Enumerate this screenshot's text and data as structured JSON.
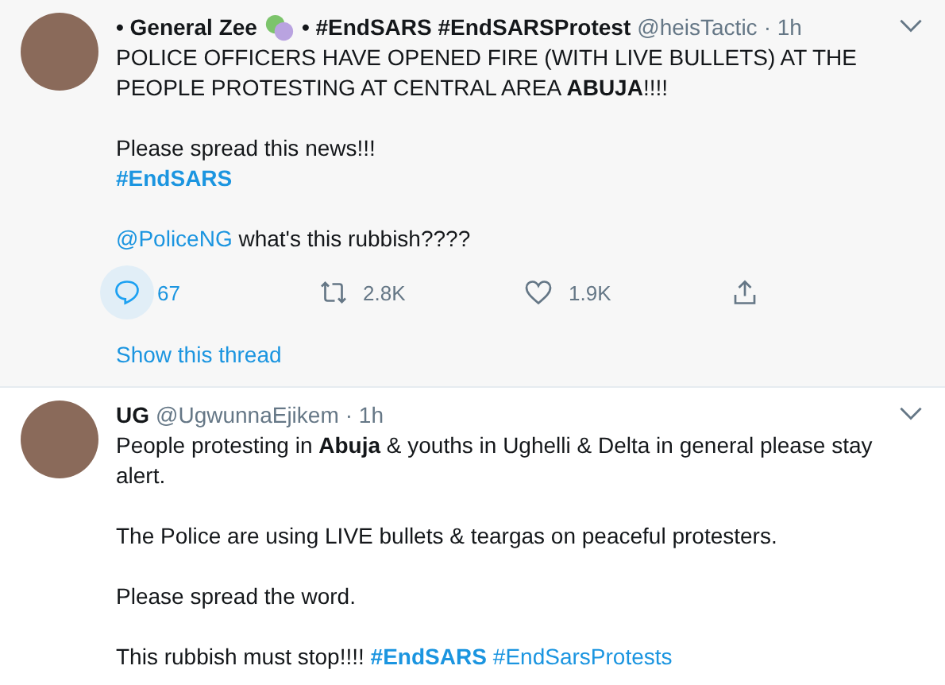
{
  "tweets": [
    {
      "name_parts": [
        "• General Zee",
        "• #EndSARS #EndSARSProtest"
      ],
      "handle": "@heisTactic",
      "time": "· 1h",
      "paragraphs": [
        [
          {
            "kind": "text",
            "text": "POLICE OFFICERS HAVE OPENED FIRE (WITH LIVE BULLETS) AT THE PEOPLE PROTESTING AT CENTRAL AREA **ABUJA**!!!!"
          }
        ],
        [
          {
            "kind": "text",
            "text": "Please spread this news!!!"
          },
          {
            "kind": "break"
          },
          {
            "kind": "hashtag",
            "text": "#EndSARS",
            "bold": true
          }
        ],
        [
          {
            "kind": "mention",
            "text": "@PoliceNG",
            "bold": false
          },
          {
            "kind": "text",
            "text": " what's this rubbish????"
          }
        ]
      ],
      "actions": [
        {
          "kind": "reply",
          "count": "67",
          "highlighted": true
        },
        {
          "kind": "retweet",
          "count": "2.8K",
          "highlighted": false
        },
        {
          "kind": "like",
          "count": "1.9K",
          "highlighted": false
        },
        {
          "kind": "share",
          "highlighted": false
        }
      ],
      "thread_link": "Show this thread"
    },
    {
      "name_parts": [
        "UG"
      ],
      "handle": "@UgwunnaEjikem",
      "time": "· 1h",
      "paragraphs": [
        [
          {
            "kind": "text",
            "text": "People protesting in **Abuja** & youths in Ughelli & Delta in general please stay alert."
          }
        ],
        [
          {
            "kind": "text",
            "text": "The Police are using LIVE bullets & teargas on peaceful protesters."
          }
        ],
        [
          {
            "kind": "text",
            "text": "Please spread the word."
          }
        ],
        [
          {
            "kind": "text",
            "text": "This rubbish must stop!!!! "
          },
          {
            "kind": "hashtag",
            "text": "#EndSARS",
            "bold": true
          },
          {
            "kind": "hashtag",
            "text": "#EndSarsProtests",
            "bold": false
          }
        ]
      ]
    }
  ]
}
